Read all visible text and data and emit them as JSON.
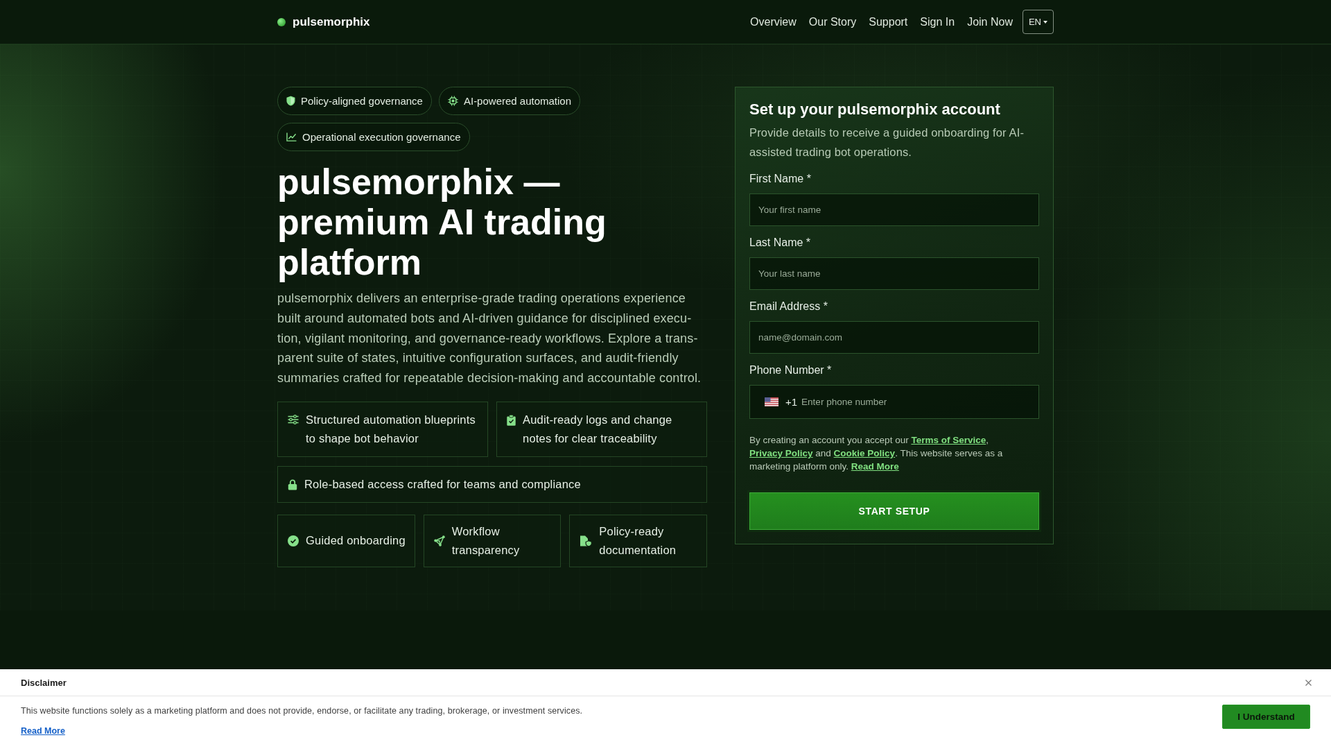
{
  "header": {
    "brand": "pulsemorphix",
    "nav": [
      "Overview",
      "Our Story",
      "Support",
      "Sign In",
      "Join Now"
    ],
    "language": "EN"
  },
  "hero": {
    "badges": [
      "Policy-aligned governance",
      "AI-powered automation",
      "Operational execution governance"
    ],
    "title": "pulsemorphix — premium AI trading platform",
    "intro": "pulsemorphix delivers an enterprise-grade trading operations experience built around automated bots and AI-driven guidance for disciplined execu-tion, vigilant monitoring, and governance-ready workflows. Explore a trans-parent suite of states, intuitive configuration surfaces, and audit-friendly summaries crafted for repeatable decision-making and accountable control.",
    "feature_rows": [
      [
        "Structured automation blueprints to shape bot behavior",
        "Audit-ready logs and change notes for clear traceability"
      ],
      [
        "Role-based access crafted for teams and compliance"
      ],
      [
        "Guided onboarding",
        "Workflow transparency",
        "Policy-ready documentation"
      ]
    ]
  },
  "signup": {
    "title": "Set up your pulsemorphix account",
    "intro": "Provide details to receive a guided onboarding for AI-assisted trading bot operations.",
    "fields": [
      {
        "kind": "text",
        "label": "First Name *",
        "placeholder": "Your first name"
      },
      {
        "kind": "text",
        "label": "Last Name *",
        "placeholder": "Your last name"
      },
      {
        "kind": "text",
        "label": "Email Address *",
        "placeholder": "name@domain.com"
      },
      {
        "kind": "phone",
        "label": "Phone Number *",
        "dial_code": "+1",
        "placeholder": "Enter phone number"
      }
    ],
    "consent": [
      {
        "kind": "text",
        "text": "By creating an account you accept our "
      },
      {
        "kind": "link",
        "text": "Terms of Service"
      },
      {
        "kind": "text",
        "text": ", "
      },
      {
        "kind": "link",
        "text": "Privacy Policy"
      },
      {
        "kind": "text",
        "text": " and "
      },
      {
        "kind": "link",
        "text": "Cookie Policy"
      },
      {
        "kind": "text",
        "text": ". This website serves as a marketing platform only. "
      },
      {
        "kind": "link",
        "text": "Read More"
      }
    ],
    "submit": "START SETUP"
  },
  "disclaimer": {
    "title": "Disclaimer",
    "text": "This website functions solely as a marketing platform and does not provide, endorse, or facilitate any trading, brokerage, or investment services.",
    "link": "Read More",
    "button": "I Understand"
  }
}
